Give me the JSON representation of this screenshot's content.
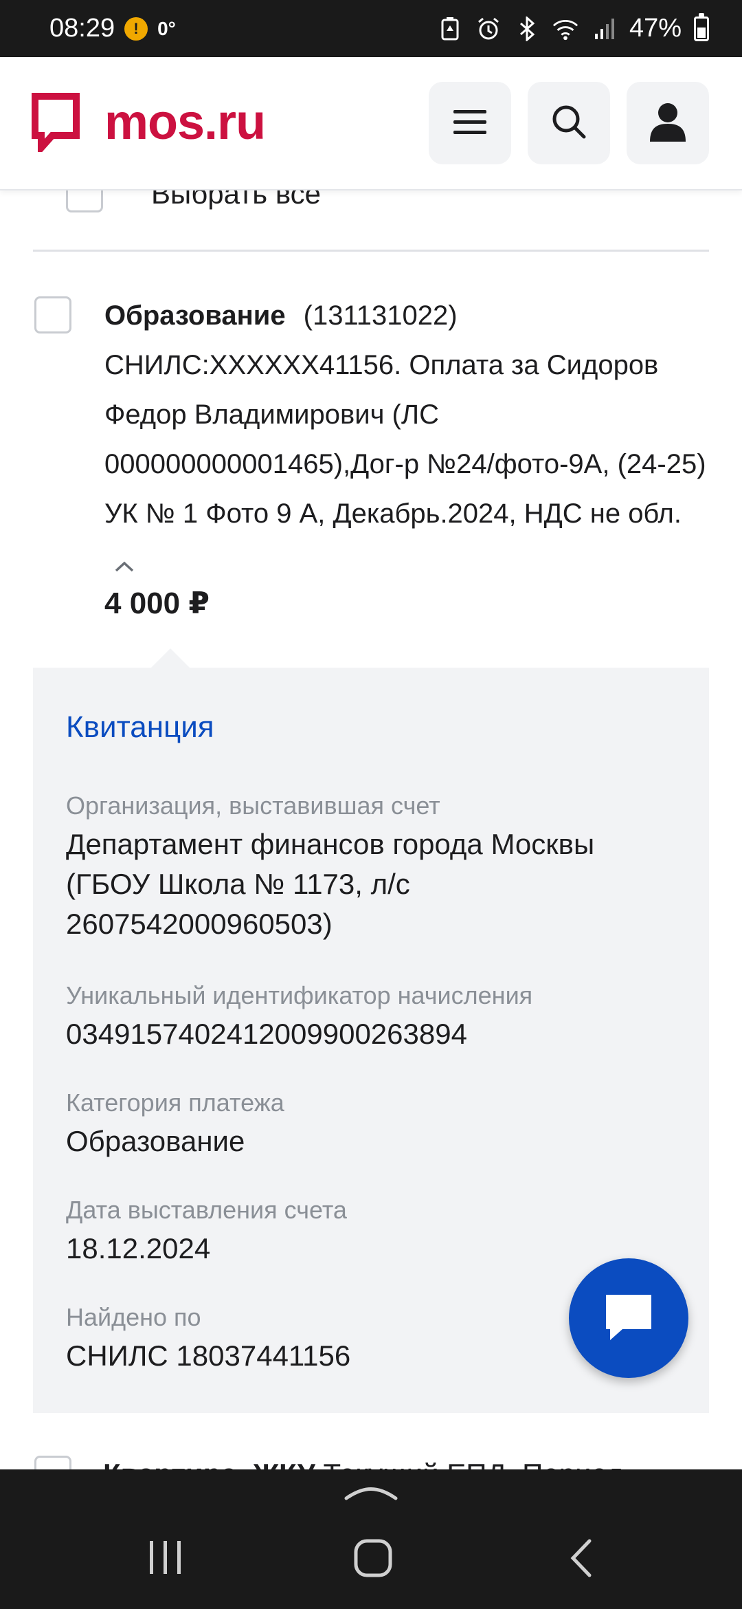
{
  "status_bar": {
    "time": "08:29",
    "temperature": "0°",
    "battery": "47%",
    "icons": [
      "alert-icon",
      "battery-saver-icon",
      "alarm-icon",
      "bluetooth-icon",
      "wifi-icon",
      "signal-icon",
      "battery-icon"
    ]
  },
  "header": {
    "logo_text": "mos.ru",
    "brand_color": "#cc1140",
    "buttons": [
      "menu-icon",
      "search-icon",
      "profile-icon"
    ]
  },
  "list": {
    "select_all_label": "Выбрать все"
  },
  "item": {
    "title": "Образование",
    "account": "(131131022)",
    "description": "СНИЛС:XXXXXX41156. Оплата за Сидоров Федор Владимирович (ЛС 000000000001465),Дог-р №24/фото-9А, (24-25) УК № 1 Фото 9 А, Декабрь.2024, НДС не обл.",
    "amount": "4 000 ₽"
  },
  "receipt": {
    "title": "Квитанция",
    "accent_color": "#0b4cc0",
    "fields": [
      {
        "label": "Организация, выставившая счет",
        "value": "Департамент финансов города Москвы (ГБОУ Школа № 1173, л/с 2607542000960503)"
      },
      {
        "label": "Уникальный идентификатор начисления",
        "value": "0349157402412009900263894"
      },
      {
        "label": "Категория платежа",
        "value": "Образование"
      },
      {
        "label": "Дата выставления счета",
        "value": "18.12.2024"
      },
      {
        "label": "Найдено по",
        "value": "СНИЛС 18037441156"
      }
    ]
  },
  "next_item": {
    "title": "Квартира, ЖКУ",
    "text": "Текущий ЕПД. Период"
  },
  "fab": {
    "icon": "chat-icon"
  },
  "nav_bar": {
    "buttons": [
      "recent-apps-icon",
      "home-icon",
      "back-icon"
    ]
  }
}
